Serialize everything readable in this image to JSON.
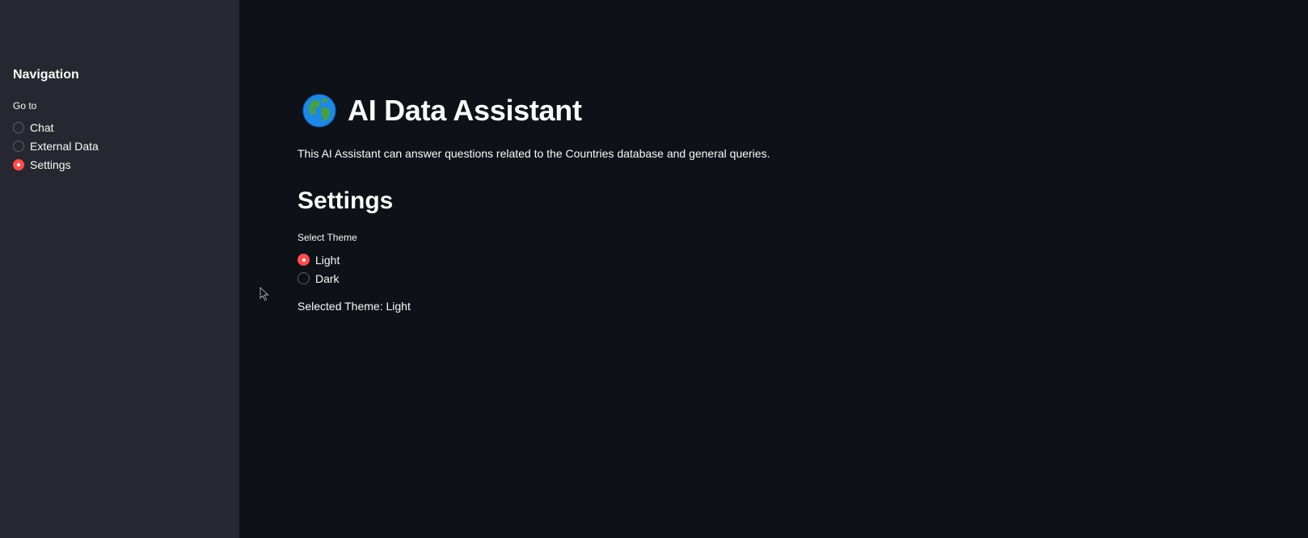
{
  "sidebar": {
    "title": "Navigation",
    "group_label": "Go to",
    "items": [
      {
        "label": "Chat",
        "selected": false
      },
      {
        "label": "External Data",
        "selected": false
      },
      {
        "label": "Settings",
        "selected": true
      }
    ]
  },
  "main": {
    "title_icon": "globe-icon",
    "title": "AI Data Assistant",
    "description": "This AI Assistant can answer questions related to the Countries database and general queries.",
    "section_title": "Settings",
    "theme_label": "Select Theme",
    "theme_options": [
      {
        "label": "Light",
        "selected": true
      },
      {
        "label": "Dark",
        "selected": false
      }
    ],
    "selected_theme_text": "Selected Theme: Light"
  },
  "colors": {
    "background": "#0e1117",
    "sidebar_background": "#262730",
    "accent": "#ff4b4b",
    "text": "#fafafa"
  }
}
